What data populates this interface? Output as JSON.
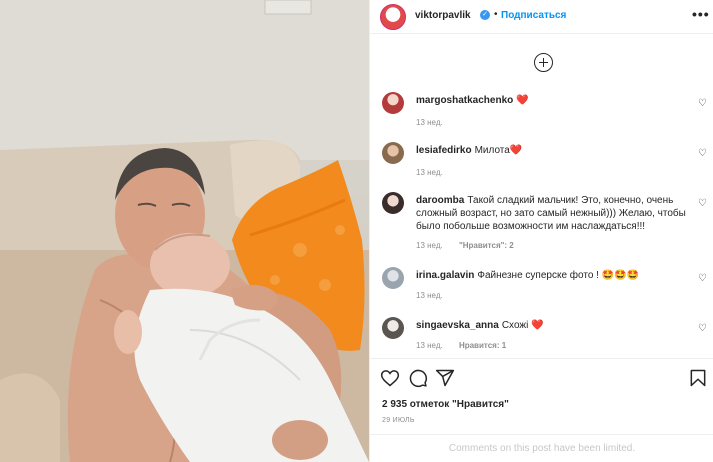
{
  "header": {
    "username": "viktorpavlik",
    "separator": "•",
    "follow_label": "Подписаться",
    "more_label": "•••"
  },
  "comments": [
    {
      "user": "margoshatkachenko",
      "text": "❤️",
      "time": "13 нед.",
      "likes": "",
      "reply": ""
    },
    {
      "user": "lesiafedirko",
      "text": "Милота❤️",
      "time": "13 нед.",
      "likes": "",
      "reply": ""
    },
    {
      "user": "daroomba",
      "text": "Такой сладкий мальчик! Это, конечно, очень сложный возраст, но зато самый нежный))) Желаю, чтобы было побольше возможности им наслаждаться!!!",
      "time": "13 нед.",
      "likes": "\"Нравится\": 2",
      "reply": ""
    },
    {
      "user": "irina.galavin",
      "text": "Файнезне суперске фото ! 🤩🤩🤩",
      "time": "13 нед.",
      "likes": "",
      "reply": ""
    },
    {
      "user": "singaevska_anna",
      "text": "Схожі ❤️",
      "time": "13 нед.",
      "likes": "Нравится: 1",
      "reply": ""
    }
  ],
  "post": {
    "likes_text": "2 935 отметок \"Нравится\"",
    "date": "29 ИЮЛЬ",
    "comments_limited": "Comments on this post have been limited."
  },
  "icons": {
    "like": "heart-icon",
    "comment": "comment-icon",
    "share": "share-icon",
    "save": "bookmark-icon",
    "load_more": "plus-circle-icon"
  },
  "colors": {
    "accent": "#0095f6",
    "heart": "#ed4956",
    "muted": "#8e8e8e",
    "pillow": "#f28a1d"
  }
}
